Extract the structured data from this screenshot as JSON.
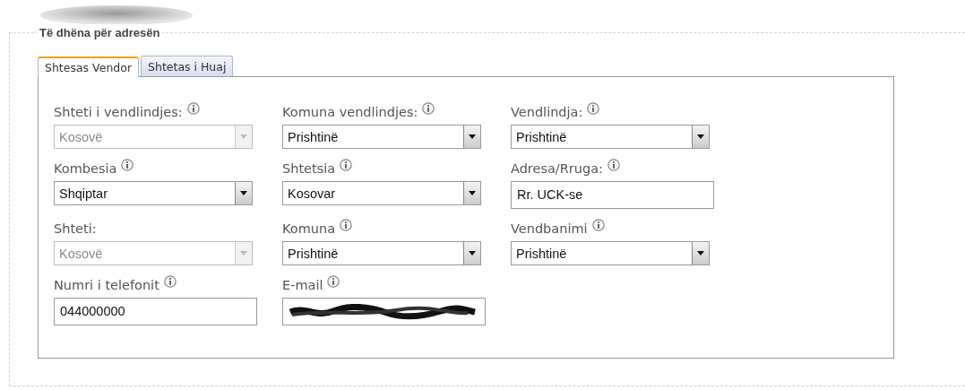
{
  "section": {
    "legend": "Të dhëna për adresën"
  },
  "tabs": [
    {
      "label": "Shtesas Vendor",
      "selected": true
    },
    {
      "label": "Shtetas i Huaj",
      "selected": false
    }
  ],
  "fields": [
    {
      "label": "Shteti i vendlindjes:",
      "info": true,
      "kind": "select",
      "value": "Kosovë",
      "disabled": true
    },
    {
      "label": "Komuna vendlindjes:",
      "info": true,
      "kind": "select",
      "value": "Prishtinë",
      "disabled": false
    },
    {
      "label": "Vendlindja:",
      "info": true,
      "kind": "select",
      "value": "Prishtinë",
      "disabled": false
    },
    {
      "label": "Kombesia",
      "info": true,
      "kind": "select",
      "value": "Shqiptar",
      "disabled": false
    },
    {
      "label": "Shtetsia",
      "info": true,
      "kind": "select",
      "value": "Kosovar",
      "disabled": false
    },
    {
      "label": "Adresa/Rruga:",
      "info": true,
      "kind": "text",
      "value": "Rr. UCK-se"
    },
    {
      "label": "Shteti:",
      "info": false,
      "kind": "select",
      "value": "Kosovë",
      "disabled": true
    },
    {
      "label": "Komuna",
      "info": true,
      "kind": "select",
      "value": "Prishtinë",
      "disabled": false
    },
    {
      "label": "Vendbanimi",
      "info": true,
      "kind": "select",
      "value": "Prishtinë",
      "disabled": false
    },
    {
      "label": "Numri i telefonit",
      "info": true,
      "kind": "text",
      "value": "044000000"
    },
    {
      "label": "E-mail",
      "info": true,
      "kind": "redacted"
    }
  ]
}
